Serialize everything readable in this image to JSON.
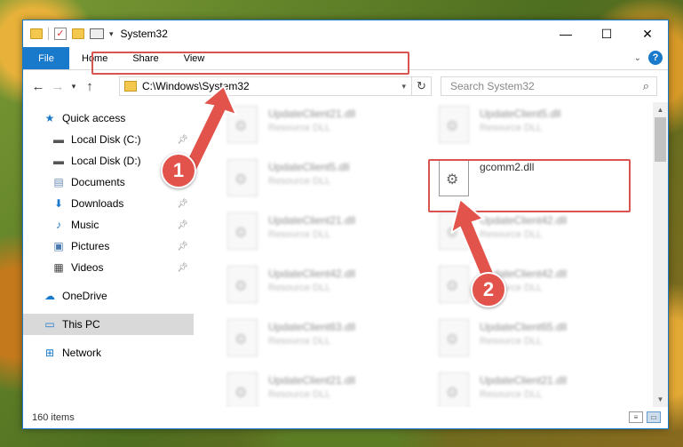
{
  "window": {
    "title": "System32",
    "controls": {
      "minimize": "—",
      "maximize": "☐",
      "close": "✕"
    }
  },
  "ribbon": {
    "tabs": [
      "File",
      "Home",
      "Share",
      "View"
    ],
    "help": "?"
  },
  "address": {
    "path": "C:\\Windows\\System32",
    "search_placeholder": "Search System32"
  },
  "nav": {
    "items": [
      {
        "label": "Quick access",
        "icon": "star-icon"
      },
      {
        "label": "Local Disk (C:)",
        "icon": "drive-icon",
        "pinned": true
      },
      {
        "label": "Local Disk (D:)",
        "icon": "drive-icon"
      },
      {
        "label": "Documents",
        "icon": "documents-icon",
        "pinned": true
      },
      {
        "label": "Downloads",
        "icon": "download-icon",
        "pinned": true
      },
      {
        "label": "Music",
        "icon": "music-icon",
        "pinned": true
      },
      {
        "label": "Pictures",
        "icon": "pictures-icon",
        "pinned": true
      },
      {
        "label": "Videos",
        "icon": "videos-icon",
        "pinned": true
      },
      {
        "label": "OneDrive",
        "icon": "cloud-icon"
      },
      {
        "label": "This PC",
        "icon": "computer-icon",
        "selected": true
      },
      {
        "label": "Network",
        "icon": "network-icon"
      }
    ]
  },
  "files": [
    {
      "name": "UpdateClient21.dll",
      "type": "Resource DLL"
    },
    {
      "name": "UpdateClient5.dll",
      "type": "Resource DLL"
    },
    {
      "name": "UpdateClient5.dll",
      "type": "Resource DLL"
    },
    {
      "name": "gcomm2.dll",
      "type": ""
    },
    {
      "name": "UpdateClient21.dll",
      "type": "Resource DLL"
    },
    {
      "name": "UpdateClient42.dll",
      "type": "Resource DLL"
    },
    {
      "name": "UpdateClient42.dll",
      "type": "Resource DLL"
    },
    {
      "name": "UpdateClient42.dll",
      "type": "Resource DLL"
    },
    {
      "name": "UpdateClient63.dll",
      "type": "Resource DLL"
    },
    {
      "name": "UpdateClient65.dll",
      "type": "Resource DLL"
    },
    {
      "name": "UpdateClient21.dll",
      "type": "Resource DLL"
    },
    {
      "name": "UpdateClient21.dll",
      "type": "Resource DLL"
    }
  ],
  "status": {
    "count": "160 items"
  },
  "callouts": {
    "one": "1",
    "two": "2"
  },
  "colors": {
    "accent": "#1979ca",
    "highlight": "#d9534f"
  }
}
